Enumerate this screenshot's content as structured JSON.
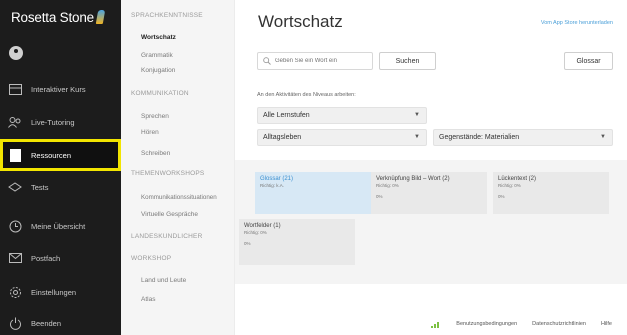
{
  "app": {
    "logo_text": "Rosetta Stone",
    "brand_color": "#1c1c1c",
    "highlight_color": "#f2e500"
  },
  "sidebar": {
    "items": [
      {
        "label": "Interaktiver Kurs",
        "icon": "course-icon"
      },
      {
        "label": "Live-Tutoring",
        "icon": "tutoring-icon"
      },
      {
        "label": "Ressourcen",
        "icon": "resources-icon",
        "active": true
      },
      {
        "label": "Tests",
        "icon": "tests-icon"
      },
      {
        "label": "Meine Übersicht",
        "icon": "overview-icon"
      },
      {
        "label": "Postfach",
        "icon": "mail-icon"
      },
      {
        "label": "Einstellungen",
        "icon": "settings-icon"
      },
      {
        "label": "Beenden",
        "icon": "power-icon"
      }
    ]
  },
  "submenu": {
    "sections": [
      {
        "heading": "SPRACHKENNTNISSE",
        "items": [
          "Wortschatz",
          "Grammatik",
          "Konjugation"
        ]
      },
      {
        "heading": "KOMMUNIKATION",
        "items": [
          "Sprechen",
          "Hören",
          "Schreiben"
        ]
      },
      {
        "heading": "THEMENWORKSHOPS",
        "items": [
          "Kommunikationssituationen",
          "Virtuelle Gespräche"
        ]
      },
      {
        "heading": "LANDESKUNDLICHER",
        "items": []
      },
      {
        "heading": "WORKSHOP",
        "items": [
          "Land und Leute",
          "Atlas"
        ]
      }
    ],
    "selected": "Wortschatz"
  },
  "main": {
    "title": "Wortschatz",
    "app_store_link": "Vom App Store herunterladen",
    "search": {
      "placeholder": "Geben Sie ein Wort ein",
      "value": ""
    },
    "search_button": "Suchen",
    "glossary_button": "Glossar",
    "filter_label": "An den Aktivitäten des Niveaus arbeiten:",
    "level_select": "Alle Lernstufen",
    "topic_select": "Alltagsleben",
    "subject_select": "Gegenstände: Materialien",
    "cards": [
      {
        "title": "Glossar (21)",
        "score": "Richtig: k.A.",
        "percent": "",
        "selected": true
      },
      {
        "title": "Verknüpfung Bild – Wort (2)",
        "score": "Richtig: 0%",
        "percent": "0%",
        "selected": false
      },
      {
        "title": "Lückentext (2)",
        "score": "Richtig: 0%",
        "percent": "0%",
        "selected": false
      },
      {
        "title": "Wortfelder (1)",
        "score": "Richtig: 0%",
        "percent": "0%",
        "selected": false
      }
    ]
  },
  "footer": {
    "links": [
      "Benutzungsbedingungen",
      "Datenschutzrichtlinien",
      "Hilfe"
    ]
  }
}
